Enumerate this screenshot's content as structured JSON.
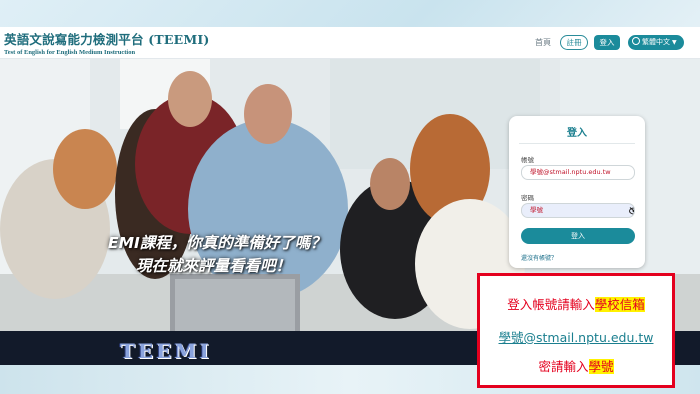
{
  "header": {
    "title": "英語文說寫能力檢測平台 (TEEMI)",
    "subtitle": "Test of English for English Medium Instruction",
    "nav_home": "首頁",
    "register_label": "註冊",
    "login_label": "登入",
    "language_label": "繁體中文"
  },
  "hero": {
    "slogan_line1": "EMI課程，你真的準備好了嗎？",
    "slogan_line2": "現在就來評量看看吧！",
    "logo_text": "TEEMI"
  },
  "login_card": {
    "title": "登入",
    "account_label": "帳號",
    "account_value": "學號@stmail.nptu.edu.tw",
    "password_label": "密碼",
    "password_value": "學號",
    "submit_label": "登入",
    "no_account_link": "還沒有帳號？"
  },
  "annotation": {
    "line1_prefix": "登入帳號請輸入",
    "line1_highlight": "學校信箱",
    "line2": "學號@stmail.nptu.edu.tw",
    "line3_prefix": "密請輸入",
    "line3_highlight": "學號"
  },
  "colors": {
    "accent": "#1b8b9b",
    "annotation_red": "#e4001e",
    "highlight_yellow": "#fff200",
    "band_dark": "#121a2a"
  }
}
